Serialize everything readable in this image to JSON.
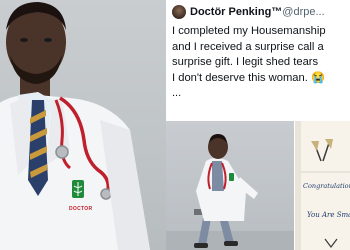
{
  "tweet": {
    "name": "Doctör Penking™",
    "handle": "@drpe...",
    "lines": [
      "I completed my Housemanship",
      "and I received a surprise call a",
      "surprise gift. I legit shed tears",
      "I don't deserve this woman. 😭"
    ],
    "more": "..."
  },
  "photos": {
    "badge_text": "DOCTOR"
  },
  "card": {
    "line1": "Congratulations",
    "line2": "You Are Sma"
  },
  "colors": {
    "coat": "#f4f5f6",
    "tie_navy": "#2b3f6b",
    "tie_gold": "#c99a3b",
    "stethoscope": "#c0202c",
    "badge_green": "#1f8a3a",
    "scrubs": "#7e8ca3"
  }
}
